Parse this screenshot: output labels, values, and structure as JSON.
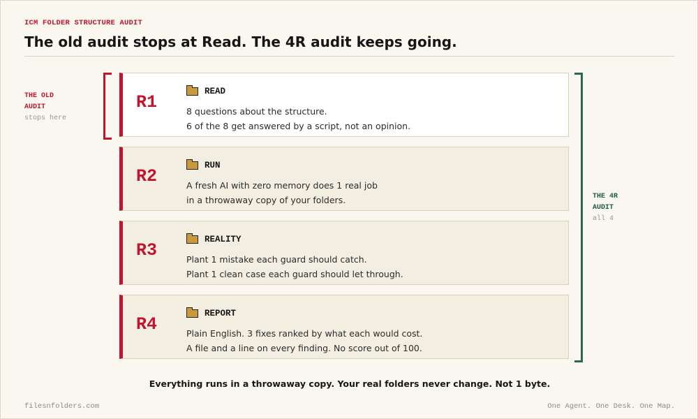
{
  "header": {
    "kicker": "ICM FOLDER STRUCTURE AUDIT",
    "title": "The old audit stops at Read. The 4R audit keeps going."
  },
  "old_audit": {
    "line1": "THE OLD",
    "line2": "AUDIT",
    "note": "stops here"
  },
  "new_audit": {
    "line1": "THE 4R",
    "line2": "AUDIT",
    "note": "all 4"
  },
  "steps": [
    {
      "id": "R1",
      "icon": "folder-icon",
      "title": "READ",
      "line1": "8 questions about the structure.",
      "line2": "6 of the 8 get answered by a script, not an opinion."
    },
    {
      "id": "R2",
      "icon": "folder-icon",
      "title": "RUN",
      "line1": "A fresh AI with zero memory does 1 real job",
      "line2": "in a throwaway copy of your folders."
    },
    {
      "id": "R3",
      "icon": "folder-icon",
      "title": "REALITY",
      "line1": "Plant 1 mistake each guard should catch.",
      "line2": "Plant 1 clean case each guard should let through."
    },
    {
      "id": "R4",
      "icon": "folder-icon",
      "title": "REPORT",
      "line1": "Plain English. 3 fixes ranked by what each would cost.",
      "line2": "A file and a line on every finding. No score out of 100."
    }
  ],
  "footnote": "Everything runs in a throwaway copy. Your real folders never change. Not 1 byte.",
  "footer": {
    "site": "filesnfolders.com",
    "tagline": "One Agent. One Desk. One Map."
  },
  "colors": {
    "accent_red": "#c0152f",
    "accent_green": "#1e5c3e",
    "folder": "#c89a3c",
    "card_bg": "#f2eee2",
    "card_active_bg": "#ffffff",
    "page_bg": "#f9f7f0"
  }
}
